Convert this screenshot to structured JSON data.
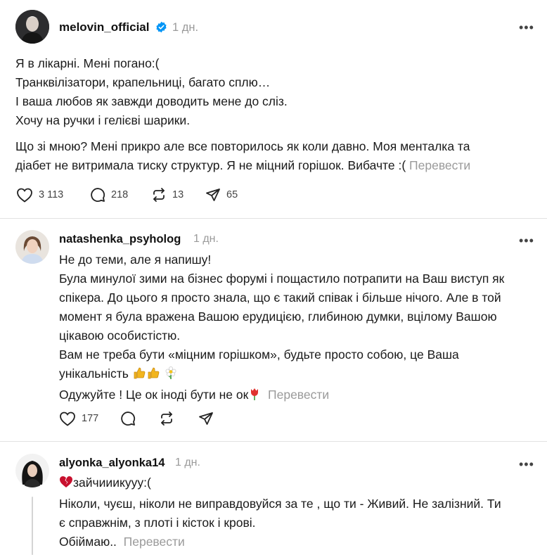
{
  "post": {
    "username": "melovin_official",
    "time": "1 дн.",
    "paragraph1": [
      "Я в лікарні. Мені погано:(",
      "Транквілізатори, крапельниці, багато сплю…",
      "І ваша любов як завжди доводить мене до сліз.",
      "Хочу на ручки і гелієві шарики."
    ],
    "paragraph2": [
      "Що зі мною? Мені прикро але все повторилось як коли давно. Моя менталка та",
      "діабет не витримала тиску структур. Я не міцний горішок. Вибачте :("
    ],
    "translate": "Перевести",
    "likes": "3 113",
    "comments": "218",
    "reposts": "13",
    "shares": "65"
  },
  "reply1": {
    "username": "natashenka_psyholog",
    "time": "1 дн.",
    "lines": [
      "Не до теми, але я напишу!",
      "Була минулої зими на бізнес форумі і пощастило потрапити на Ваш виступ як",
      "спікера. До цього я просто знала, що є такий співак і більше нічого. Але в той",
      "момент я була вражена Вашою ерудицією, глибиною думки, вцілому Вашою",
      "цікавою особистістю.",
      "Вам не треба бути «міцним горішком», будьте просто собою, це Ваша"
    ],
    "line_emoji": "унікальність",
    "last_line": "Одужуйте ! Це ок іноді бути не ок",
    "translate": "Перевести",
    "likes": "177"
  },
  "reply2": {
    "username": "alyonka_alyonka14",
    "time": "1 дн.",
    "first_line": "зайчииикууу:(",
    "lines": [
      "Ніколи, чуєш, ніколи не виправдовуйся за те , що ти - Живий. Не залізний. Ти",
      "є справжнім, з плоті і кісток і крові."
    ],
    "last_line": "Обіймаю..",
    "translate": "Перевести"
  },
  "icons": {
    "more": "more-icon",
    "verified": "verified-badge-icon",
    "like": "heart-icon",
    "comment": "comment-icon",
    "repost": "repost-icon",
    "share": "share-icon"
  },
  "colors": {
    "verified": "#0095f6",
    "muted": "#9a9a9a",
    "text": "#1a1a1a",
    "divider": "#e2e2e2"
  }
}
